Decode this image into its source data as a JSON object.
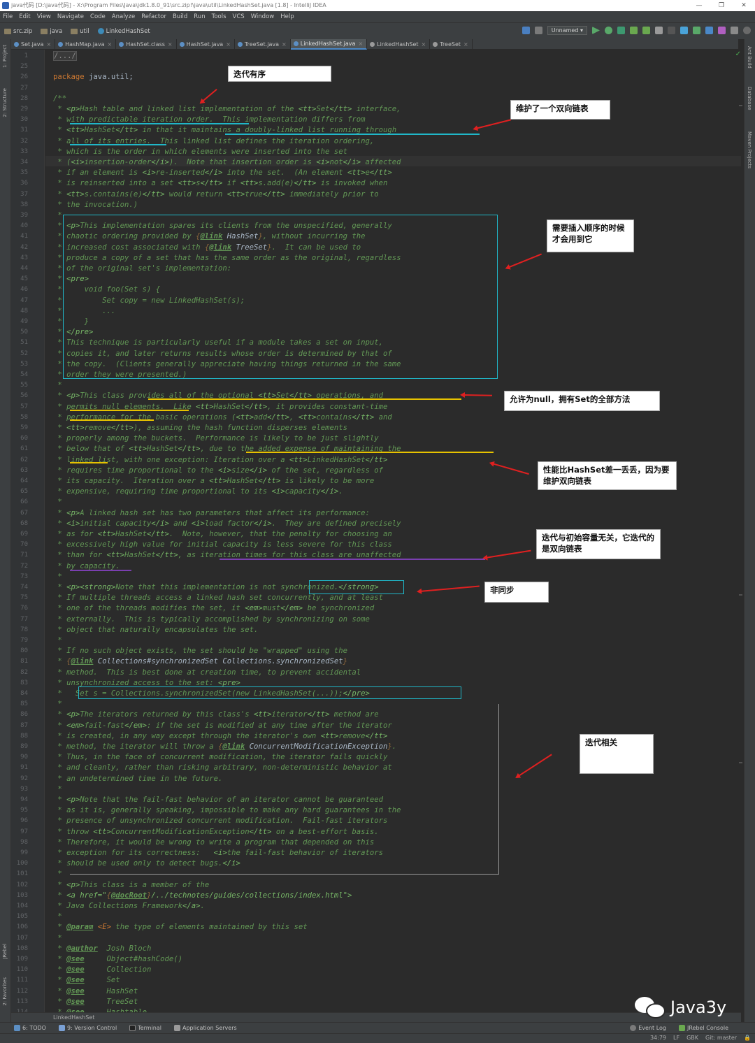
{
  "window": {
    "title": "java代码 [D:\\java代码] - X:\\Program Files\\Java\\jdk1.8.0_91\\src.zip!\\java\\util\\LinkedHashSet.java [1.8] - IntelliJ IDEA",
    "controls": [
      "—",
      "❐",
      "✕"
    ]
  },
  "menu": [
    "File",
    "Edit",
    "View",
    "Navigate",
    "Code",
    "Analyze",
    "Refactor",
    "Build",
    "Run",
    "Tools",
    "VCS",
    "Window",
    "Help"
  ],
  "breadcrumbs": [
    "src.zip",
    "java",
    "util",
    "LinkedHashSet"
  ],
  "run_config": "Unnamed",
  "tabs": [
    {
      "label": "Set.java",
      "active": false
    },
    {
      "label": "HashMap.java",
      "active": false
    },
    {
      "label": "HashSet.class",
      "active": false
    },
    {
      "label": "HashSet.java",
      "active": false
    },
    {
      "label": "TreeSet.java",
      "active": false
    },
    {
      "label": "LinkedHashSet.java",
      "active": true
    },
    {
      "label": "LinkedHashSet",
      "active": false
    },
    {
      "label": "TreeSet",
      "active": false
    }
  ],
  "tab_close": "×",
  "left_tools": [
    "1: Project",
    "2: Structure",
    "JRebel",
    "2: Favorites"
  ],
  "right_tools": [
    "Ant Build",
    "Database",
    "Maven Projects"
  ],
  "code_lines": [
    {
      "n": "1",
      "t": "/.../",
      "k": "fold"
    },
    {
      "n": "25",
      "t": ""
    },
    {
      "n": "26",
      "kw": "package",
      "rest": " java.util;",
      "k": "pkg"
    },
    {
      "n": "27",
      "t": ""
    },
    {
      "n": "28",
      "t": "/**"
    },
    {
      "n": "29",
      "t": " * <p>Hash table and linked list implementation of the <tt>Set</tt> interface,"
    },
    {
      "n": "30",
      "t": " * with predictable iteration order.  This implementation differs from"
    },
    {
      "n": "31",
      "t": " * <tt>HashSet</tt> in that it maintains a doubly-linked list running through"
    },
    {
      "n": "32",
      "t": " * all of its entries.  This linked list defines the iteration ordering,"
    },
    {
      "n": "33",
      "t": " * which is the order in which elements were inserted into the set"
    },
    {
      "n": "34",
      "t": " * (<i>insertion-order</i>).  Note that insertion order is <i>not</i> affected"
    },
    {
      "n": "35",
      "t": " * if an element is <i>re-inserted</i> into the set.  (An element <tt>e</tt>"
    },
    {
      "n": "36",
      "t": " * is reinserted into a set <tt>s</tt> if <tt>s.add(e)</tt> is invoked when"
    },
    {
      "n": "37",
      "t": " * <tt>s.contains(e)</tt> would return <tt>true</tt> immediately prior to"
    },
    {
      "n": "38",
      "t": " * the invocation.)"
    },
    {
      "n": "39",
      "t": " *"
    },
    {
      "n": "40",
      "t": " * <p>This implementation spares its clients from the unspecified, generally"
    },
    {
      "n": "41",
      "t": " * chaotic ordering provided by {@link HashSet}, without incurring the"
    },
    {
      "n": "42",
      "t": " * increased cost associated with {@link TreeSet}.  It can be used to"
    },
    {
      "n": "43",
      "t": " * produce a copy of a set that has the same order as the original, regardless"
    },
    {
      "n": "44",
      "t": " * of the original set's implementation:"
    },
    {
      "n": "45",
      "t": " * <pre>"
    },
    {
      "n": "46",
      "t": " *     void foo(Set s) {"
    },
    {
      "n": "47",
      "t": " *         Set copy = new LinkedHashSet(s);"
    },
    {
      "n": "48",
      "t": " *         ..."
    },
    {
      "n": "49",
      "t": " *     }"
    },
    {
      "n": "50",
      "t": " * </pre>"
    },
    {
      "n": "51",
      "t": " * This technique is particularly useful if a module takes a set on input,"
    },
    {
      "n": "52",
      "t": " * copies it, and later returns results whose order is determined by that of"
    },
    {
      "n": "53",
      "t": " * the copy.  (Clients generally appreciate having things returned in the same"
    },
    {
      "n": "54",
      "t": " * order they were presented.)"
    },
    {
      "n": "55",
      "t": " *"
    },
    {
      "n": "56",
      "t": " * <p>This class provides all of the optional <tt>Set</tt> operations, and"
    },
    {
      "n": "57",
      "t": " * permits null elements.  Like <tt>HashSet</tt>, it provides constant-time"
    },
    {
      "n": "58",
      "t": " * performance for the basic operations (<tt>add</tt>, <tt>contains</tt> and"
    },
    {
      "n": "59",
      "t": " * <tt>remove</tt>), assuming the hash function disperses elements"
    },
    {
      "n": "60",
      "t": " * properly among the buckets.  Performance is likely to be just slightly"
    },
    {
      "n": "61",
      "t": " * below that of <tt>HashSet</tt>, due to the added expense of maintaining the"
    },
    {
      "n": "62",
      "t": " * linked list, with one exception: Iteration over a <tt>LinkedHashSet</tt>"
    },
    {
      "n": "63",
      "t": " * requires time proportional to the <i>size</i> of the set, regardless of"
    },
    {
      "n": "64",
      "t": " * its capacity.  Iteration over a <tt>HashSet</tt> is likely to be more"
    },
    {
      "n": "65",
      "t": " * expensive, requiring time proportional to its <i>capacity</i>."
    },
    {
      "n": "66",
      "t": " *"
    },
    {
      "n": "67",
      "t": " * <p>A linked hash set has two parameters that affect its performance:"
    },
    {
      "n": "68",
      "t": " * <i>initial capacity</i> and <i>load factor</i>.  They are defined precisely"
    },
    {
      "n": "69",
      "t": " * as for <tt>HashSet</tt>.  Note, however, that the penalty for choosing an"
    },
    {
      "n": "70",
      "t": " * excessively high value for initial capacity is less severe for this class"
    },
    {
      "n": "71",
      "t": " * than for <tt>HashSet</tt>, as iteration times for this class are unaffected"
    },
    {
      "n": "72",
      "t": " * by capacity."
    },
    {
      "n": "73",
      "t": " *"
    },
    {
      "n": "74",
      "t": " * <p><strong>Note that this implementation is not synchronized.</strong>"
    },
    {
      "n": "75",
      "t": " * If multiple threads access a linked hash set concurrently, and at least"
    },
    {
      "n": "76",
      "t": " * one of the threads modifies the set, it <em>must</em> be synchronized"
    },
    {
      "n": "77",
      "t": " * externally.  This is typically accomplished by synchronizing on some"
    },
    {
      "n": "78",
      "t": " * object that naturally encapsulates the set."
    },
    {
      "n": "79",
      "t": " *"
    },
    {
      "n": "80",
      "t": " * If no such object exists, the set should be \"wrapped\" using the"
    },
    {
      "n": "81",
      "t": " * {@link Collections#synchronizedSet Collections.synchronizedSet}"
    },
    {
      "n": "82",
      "t": " * method.  This is best done at creation time, to prevent accidental"
    },
    {
      "n": "83",
      "t": " * unsynchronized access to the set: <pre>"
    },
    {
      "n": "84",
      "t": " *   Set s = Collections.synchronizedSet(new LinkedHashSet(...));</pre>"
    },
    {
      "n": "85",
      "t": " *"
    },
    {
      "n": "86",
      "t": " * <p>The iterators returned by this class's <tt>iterator</tt> method are"
    },
    {
      "n": "87",
      "t": " * <em>fail-fast</em>: if the set is modified at any time after the iterator"
    },
    {
      "n": "88",
      "t": " * is created, in any way except through the iterator's own <tt>remove</tt>"
    },
    {
      "n": "89",
      "t": " * method, the iterator will throw a {@link ConcurrentModificationException}."
    },
    {
      "n": "90",
      "t": " * Thus, in the face of concurrent modification, the iterator fails quickly"
    },
    {
      "n": "91",
      "t": " * and cleanly, rather than risking arbitrary, non-deterministic behavior at"
    },
    {
      "n": "92",
      "t": " * an undetermined time in the future."
    },
    {
      "n": "93",
      "t": " *"
    },
    {
      "n": "94",
      "t": " * <p>Note that the fail-fast behavior of an iterator cannot be guaranteed"
    },
    {
      "n": "95",
      "t": " * as it is, generally speaking, impossible to make any hard guarantees in the"
    },
    {
      "n": "96",
      "t": " * presence of unsynchronized concurrent modification.  Fail-fast iterators"
    },
    {
      "n": "97",
      "t": " * throw <tt>ConcurrentModificationException</tt> on a best-effort basis."
    },
    {
      "n": "98",
      "t": " * Therefore, it would be wrong to write a program that depended on this"
    },
    {
      "n": "99",
      "t": " * exception for its correctness:   <i>the fail-fast behavior of iterators"
    },
    {
      "n": "100",
      "t": " * should be used only to detect bugs.</i>"
    },
    {
      "n": "101",
      "t": " *"
    },
    {
      "n": "102",
      "t": " * <p>This class is a member of the"
    },
    {
      "n": "103",
      "t": " * <a href=\"{@docRoot}/../technotes/guides/collections/index.html\">"
    },
    {
      "n": "104",
      "t": " * Java Collections Framework</a>."
    },
    {
      "n": "105",
      "t": " *"
    },
    {
      "n": "106",
      "t": " * @param <E> the type of elements maintained by this set"
    },
    {
      "n": "107",
      "t": " *"
    },
    {
      "n": "108",
      "t": " * @author  Josh Bloch"
    },
    {
      "n": "109",
      "t": " * @see     Object#hashCode()"
    },
    {
      "n": "110",
      "t": " * @see     Collection"
    },
    {
      "n": "111",
      "t": " * @see     Set"
    },
    {
      "n": "112",
      "t": " * @see     HashSet"
    },
    {
      "n": "113",
      "t": " * @see     TreeSet"
    },
    {
      "n": "114",
      "t": " * @see     Hashtable"
    }
  ],
  "annotations": [
    {
      "id": "ordered",
      "text": "迭代有序"
    },
    {
      "id": "dll",
      "text": "维护了一个双向链表"
    },
    {
      "id": "order-needed",
      "text": "需要插入顺序的时候才会用到它"
    },
    {
      "id": "null",
      "text": "允许为null，拥有Set的全部方法"
    },
    {
      "id": "perf",
      "text": "性能比HashSet差一丢丢，因为要维护双向链表"
    },
    {
      "id": "capacity",
      "text": "迭代与初始容量无关，它迭代的是双向链表"
    },
    {
      "id": "sync",
      "text": "非同步"
    },
    {
      "id": "iter",
      "text": "迭代相关"
    }
  ],
  "bottom_filename": "LinkedHashSet",
  "tool_windows": [
    "6: TODO",
    "9: Version Control",
    "Terminal",
    "Application Servers"
  ],
  "tool_windows_right": [
    "Event Log",
    "JRebel Console"
  ],
  "status": {
    "position": "34:79",
    "line_sep": "LF",
    "encoding": "GBK",
    "git": "Git: master"
  },
  "watermark": "Java3y",
  "colors": {
    "bg": "#2b2b2b",
    "doc_comment": "#629755",
    "keyword": "#cc7832",
    "annotation_box": "#20b7c8",
    "arrow": "#e02020",
    "underline_teal": "#20b7c8",
    "underline_yellow": "#e6c200",
    "underline_purple": "#7a3fb0"
  }
}
